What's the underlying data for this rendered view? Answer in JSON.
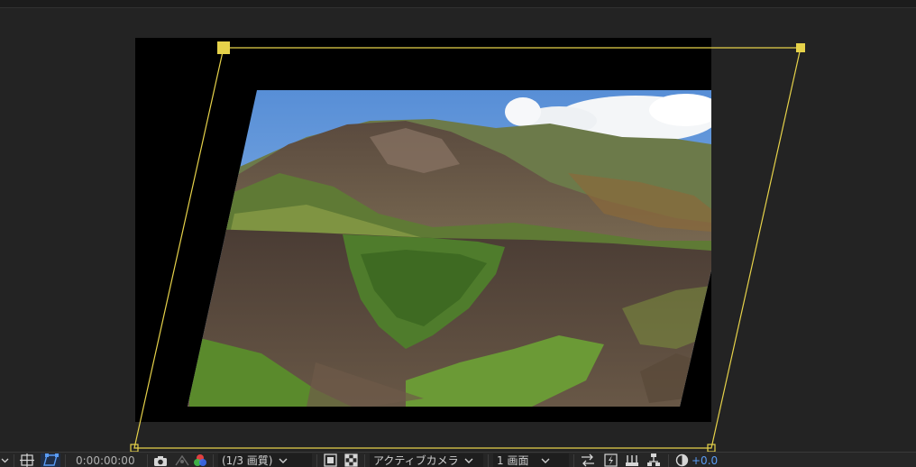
{
  "viewer": {
    "photo_description": "Volcanic crater with green vegetation in the bowl, a brown mountain ridge under a blue sky with white clouds"
  },
  "toolbar": {
    "timecode": "0:00:00:00",
    "resolution": "(1/3 画質)",
    "view_label": "アクティブカメラ",
    "layout_label": "1 画面",
    "exposure": "+0.0"
  },
  "colors": {
    "mask_path": "#e6d24a",
    "accent": "#5a9cf5"
  },
  "icons": {
    "toggle": "chevron-down-icon",
    "grid": "grid-guides-icon",
    "mask": "mask-path-icon",
    "snapshot": "camera-icon",
    "show_snapshot": "snapshot-show-icon",
    "channel": "rgb-channel-icon",
    "transparency": "checkerboard-icon",
    "region": "region-of-interest-icon",
    "flowchart": "flowchart-icon",
    "fast_preview": "fast-preview-icon",
    "render": "render-icon",
    "reset_exposure": "reset-exposure-icon"
  }
}
